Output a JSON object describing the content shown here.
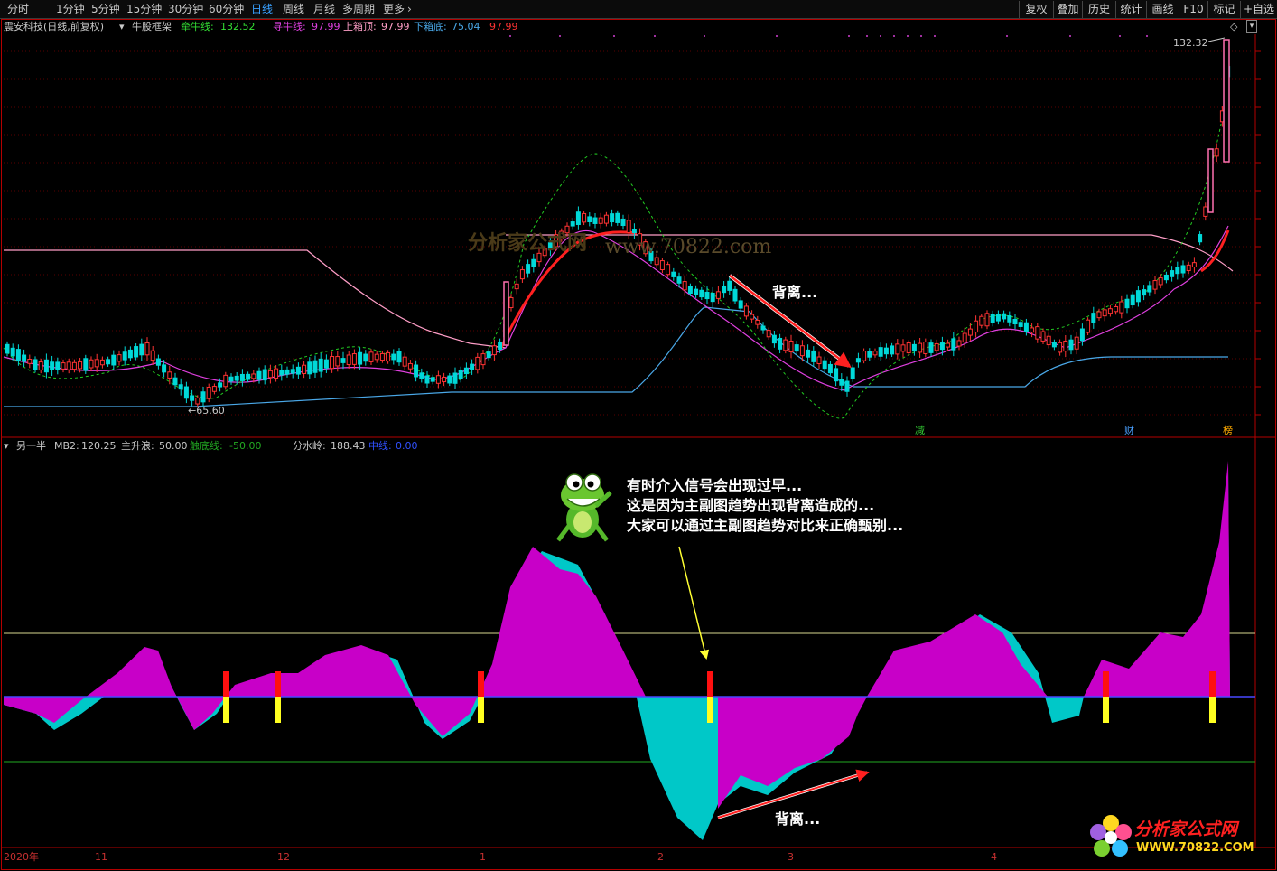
{
  "toolbar": {
    "periods": [
      "分时",
      "1分钟",
      "5分钟",
      "15分钟",
      "30分钟",
      "60分钟",
      "日线",
      "周线",
      "月线",
      "多周期",
      "更多"
    ],
    "active_period": "日线",
    "more_chevron": "›",
    "buttons": [
      "复权",
      "叠加",
      "历史",
      "统计",
      "画线",
      "F10",
      "标记",
      "+自选"
    ]
  },
  "main_header": {
    "stock": "震安科技(日线,前复权)",
    "indicator": "牛股框架",
    "qianniu_label": "牵牛线:",
    "qianniu_value": "132.52",
    "xunniu_label": "寻牛线:",
    "xunniu_value": "97.99",
    "shangxiang_label": "上箱顶:",
    "shangxiang_value": "97.99",
    "xiaxiang_label": "下箱底:",
    "xiaxiang_value": "75.04",
    "extra_value": "97.99"
  },
  "main_chart": {
    "high_label": "132.32",
    "low_label": "←65.60",
    "markers": [
      {
        "text": "减",
        "color": "#33cc33"
      },
      {
        "text": "财",
        "color": "#4aa0ff"
      },
      {
        "text": "榜",
        "color": "#ffaa00"
      }
    ],
    "divergence_note": "背离..."
  },
  "sub_header": {
    "indicator": "另一半",
    "mb2_label": "MB2:",
    "mb2_value": "120.25",
    "zhusheng_label": "主升浪:",
    "zhusheng_value": "50.00",
    "chudi_label": "触底线:",
    "chudi_value": "-50.00",
    "fenshui_label": "分水岭:",
    "fenshui_value": "188.43",
    "zhongxian_label": "中线:",
    "zhongxian_value": "0.00"
  },
  "sub_chart": {
    "divergence_note": "背离...",
    "frog_note_lines": [
      "有时介入信号会出现过早...",
      "这是因为主副图趋势出现背离造成的...",
      "大家可以通过主副图趋势对比来正确甄别..."
    ]
  },
  "date_axis": [
    "2020年",
    "11",
    "12",
    "1",
    "2",
    "3",
    "4"
  ],
  "logo": {
    "name": "分析家公式网",
    "url": "WWW.70822.COM"
  },
  "watermark": {
    "text": "分析家公式网",
    "url": "www.70822.com"
  },
  "colors": {
    "up": "#ff3333",
    "down": "#00d8d8",
    "magenta": "#d000d0",
    "cyan": "#00c8c8",
    "frame": "#b40000"
  }
}
